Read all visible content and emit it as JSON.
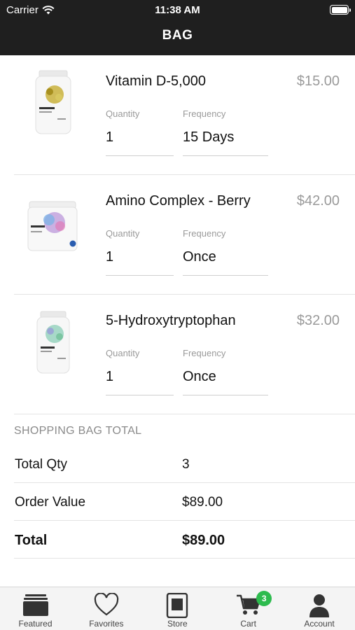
{
  "status_bar": {
    "carrier": "Carrier",
    "time": "11:38 AM"
  },
  "nav": {
    "title": "BAG"
  },
  "labels": {
    "quantity": "Quantity",
    "frequency": "Frequency"
  },
  "items": [
    {
      "name": "Vitamin D-5,000",
      "price": "$15.00",
      "quantity": "1",
      "frequency": "15 Days",
      "image": "vitamin-d-bottle"
    },
    {
      "name": "Amino Complex - Berry",
      "price": "$42.00",
      "quantity": "1",
      "frequency": "Once",
      "image": "amino-complex-tub"
    },
    {
      "name": "5-Hydroxytryptophan",
      "price": "$32.00",
      "quantity": "1",
      "frequency": "Once",
      "image": "5-htp-bottle"
    }
  ],
  "summary": {
    "heading": "SHOPPING BAG TOTAL",
    "rows": [
      {
        "label": "Total Qty",
        "value": "3"
      },
      {
        "label": "Order Value",
        "value": "$89.00"
      },
      {
        "label": "Total",
        "value": "$89.00"
      }
    ]
  },
  "tabbar": {
    "tabs": [
      {
        "label": "Featured",
        "icon": "featured-icon"
      },
      {
        "label": "Favorites",
        "icon": "heart-icon"
      },
      {
        "label": "Store",
        "icon": "store-icon"
      },
      {
        "label": "Cart",
        "icon": "cart-icon",
        "badge": "3"
      },
      {
        "label": "Account",
        "icon": "account-icon"
      }
    ]
  },
  "colors": {
    "header_bg": "#1f1f1f",
    "badge": "#2dbb4e",
    "price": "#9a9a9a"
  }
}
